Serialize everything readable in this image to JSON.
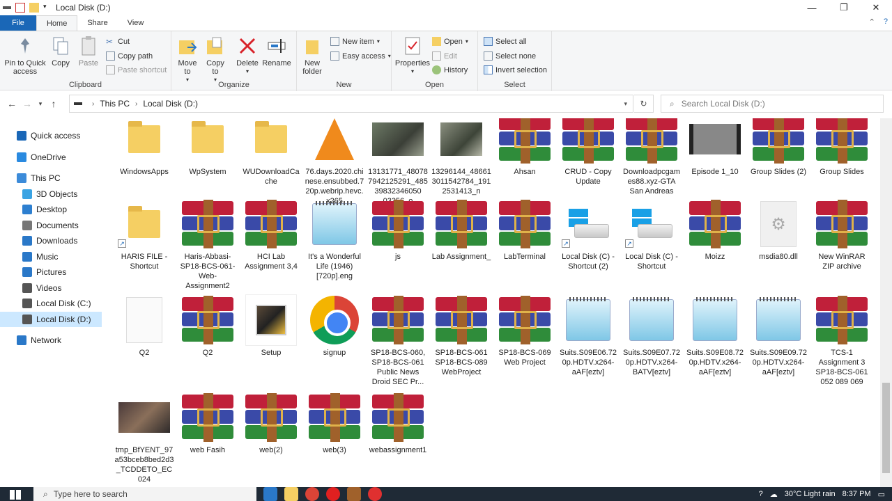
{
  "window": {
    "title": "Local Disk (D:)"
  },
  "tabs": [
    {
      "label": "File"
    },
    {
      "label": "Home"
    },
    {
      "label": "Share"
    },
    {
      "label": "View"
    }
  ],
  "ribbon": {
    "clipboard": {
      "label": "Clipboard",
      "pin": "Pin to Quick access",
      "copy": "Copy",
      "paste": "Paste",
      "cut": "Cut",
      "copy_path": "Copy path",
      "paste_shortcut": "Paste shortcut"
    },
    "organize": {
      "label": "Organize",
      "move_to": "Move to",
      "copy_to": "Copy to",
      "delete": "Delete",
      "rename": "Rename"
    },
    "new": {
      "label": "New",
      "new_folder": "New folder",
      "new_item": "New item",
      "easy_access": "Easy access"
    },
    "open": {
      "label": "Open",
      "properties": "Properties",
      "open": "Open",
      "edit": "Edit",
      "history": "History"
    },
    "select": {
      "label": "Select",
      "select_all": "Select all",
      "select_none": "Select none",
      "invert": "Invert selection"
    }
  },
  "address": {
    "crumbs": [
      "This PC",
      "Local Disk (D:)"
    ],
    "search_placeholder": "Search Local Disk (D:)"
  },
  "nav": [
    {
      "label": "Quick access",
      "color": "#1a67b7"
    },
    {
      "label": "OneDrive",
      "color": "#2a8ae0"
    },
    {
      "label": "This PC",
      "color": "#3c8bd9"
    },
    {
      "label": "3D Objects",
      "color": "#3aa3e3"
    },
    {
      "label": "Desktop",
      "color": "#2d7fd0"
    },
    {
      "label": "Documents",
      "color": "#777777"
    },
    {
      "label": "Downloads",
      "color": "#2a78c8"
    },
    {
      "label": "Music",
      "color": "#2a78c8"
    },
    {
      "label": "Pictures",
      "color": "#2a78c8"
    },
    {
      "label": "Videos",
      "color": "#555555"
    },
    {
      "label": "Local Disk (C:)",
      "color": "#555555"
    },
    {
      "label": "Local Disk (D:)",
      "color": "#555555"
    },
    {
      "label": "Network",
      "color": "#2a78c8"
    }
  ],
  "files": [
    {
      "label": "WindowsApps",
      "icon": "folder"
    },
    {
      "label": "WpSystem",
      "icon": "folder"
    },
    {
      "label": "WUDownloadCache",
      "icon": "folder"
    },
    {
      "label": "76.days.2020.chinese.ensubbed.720p.webrip.hevc.x265",
      "icon": "vlc"
    },
    {
      "label": "13131771_480787942125291_48539832346050 03356_o",
      "icon": "photo"
    },
    {
      "label": "13296144_486613011542784_1912531413_n",
      "icon": "photo2"
    },
    {
      "label": "Ahsan",
      "icon": "winrar"
    },
    {
      "label": "CRUD - Copy Update",
      "icon": "winrar"
    },
    {
      "label": "Downloadpcgames88.xyz-GTA San Andreas",
      "icon": "winrar"
    },
    {
      "label": "Episode 1_10",
      "icon": "video"
    },
    {
      "label": "Group Slides (2)",
      "icon": "winrar"
    },
    {
      "label": "Group Slides",
      "icon": "winrar"
    },
    {
      "label": "HARIS FILE - Shortcut",
      "icon": "folder-shortcut"
    },
    {
      "label": "Haris-Abbasi-SP18-BCS-061-Web-Assignment2",
      "icon": "winrar"
    },
    {
      "label": "HCI Lab Assignment 3,4",
      "icon": "winrar"
    },
    {
      "label": "It's a Wonderful Life (1946) [720p].eng",
      "icon": "notepad"
    },
    {
      "label": "js",
      "icon": "winrar"
    },
    {
      "label": "Lab Assignment_",
      "icon": "winrar"
    },
    {
      "label": "LabTerminal",
      "icon": "winrar"
    },
    {
      "label": "Local Disk (C) - Shortcut (2)",
      "icon": "drive"
    },
    {
      "label": "Local Disk (C) - Shortcut",
      "icon": "drive"
    },
    {
      "label": "Moizz",
      "icon": "winrar"
    },
    {
      "label": "msdia80.dll",
      "icon": "dll"
    },
    {
      "label": "New WinRAR ZIP archive",
      "icon": "winrar"
    },
    {
      "label": "Q2",
      "icon": "doc"
    },
    {
      "label": "Q2",
      "icon": "winrar"
    },
    {
      "label": "Setup",
      "icon": "setup"
    },
    {
      "label": "signup",
      "icon": "chrome"
    },
    {
      "label": "SP18-BCS-060, SP18-BCS-061 Public News Droid SEC Pr...",
      "icon": "winrar"
    },
    {
      "label": "SP18-BCS-061 SP18-BCS-089 WebProject",
      "icon": "winrar"
    },
    {
      "label": "SP18-BCS-069 Web Project",
      "icon": "winrar"
    },
    {
      "label": "Suits.S09E06.720p.HDTV.x264-aAF[eztv]",
      "icon": "notepad"
    },
    {
      "label": "Suits.S09E07.720p.HDTV.x264-BATV[eztv]",
      "icon": "notepad"
    },
    {
      "label": "Suits.S09E08.720p.HDTV.x264-aAF[eztv]",
      "icon": "notepad"
    },
    {
      "label": "Suits.S09E09.720p.HDTV.x264-aAF[eztv]",
      "icon": "notepad"
    },
    {
      "label": "TCS-1 Assignment 3 SP18-BCS-061 052 089 069",
      "icon": "winrar"
    },
    {
      "label": "tmp_BfYENT_97a53bceb8bed2d3_TCDDETO_EC024",
      "icon": "photo3"
    },
    {
      "label": "web Fasih",
      "icon": "winrar"
    },
    {
      "label": "web(2)",
      "icon": "winrar"
    },
    {
      "label": "web(3)",
      "icon": "winrar"
    },
    {
      "label": "webassignment1",
      "icon": "winrar"
    }
  ],
  "taskbar": {
    "search_placeholder": "Type here to search",
    "weather": "30°C  Light rain",
    "time": "8:37 PM"
  }
}
